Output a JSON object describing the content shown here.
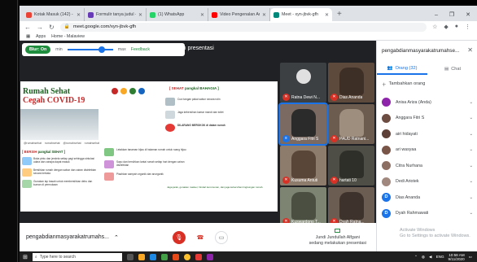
{
  "browser": {
    "tabs": [
      {
        "title": "Kotak Masuk (142) - anise@h",
        "color": "#ea4335",
        "active": false
      },
      {
        "title": "Formulir tanya judul - Googl",
        "color": "#673ab7",
        "active": false
      },
      {
        "title": "(1) WhatsApp",
        "color": "#25d366",
        "active": false
      },
      {
        "title": "Video Pengenalan Arsitektur Ulr",
        "color": "#ff0000",
        "active": false
      },
      {
        "title": "Meet - xyn-jbvk-gfh",
        "color": "#00897b",
        "active": true
      }
    ],
    "new_tab": "+",
    "url": "meet.google.com/xyn-jbvk-gfh",
    "bookmarks": [
      "Apps",
      "Home - Malaview"
    ]
  },
  "blur_bar": {
    "toggle": "Blur: On",
    "min": "min",
    "max": "max",
    "feedback": "Feedback"
  },
  "meet": {
    "presenting_title": "akukan presentasi",
    "meeting_name": "pengabdianmasyarakatrumahs...",
    "presenter_text": "Jundi Jundullah Alfgani",
    "presenter_sub": "sedang melakukan presentasi"
  },
  "slide": {
    "title_line1": "Rumah Sehat",
    "title_line2": "Cegah COVID-19",
    "bersih_prefix": "[ BERSIH",
    "bersih_suffix": "pangkal SEHAT ]",
    "sehat_prefix": "[ SEHAT",
    "sehat_suffix": "pangkal BAHAGIA ]",
    "contacts": [
      "@rumahsehat",
      "rumahsehat",
      "@rumahsehat",
      "rumahsehat"
    ],
    "left_items": [
      "Buka pintu dan jendela setiap pagi sehingga sirkulasi udara dan cahaya dapat masuk",
      "Bersihkan rumah dengan sabun dan cairan disinfektan secara berkala",
      "Gunakan lap basah untuk membersihkan debu dan kuman di permukaan"
    ],
    "mid_items": [
      "Letakkan tanaman hijau di halaman rumah untuk ruang hijau",
      "Sapu dan bersihkan lantai rumah setiap hari dengan cairan disinfektan",
      "Pisahkan sampah organik dan anorganik"
    ],
    "right_items": [
      "Cuci tangan pakai sabun secara rutin",
      "Jaga kebersihan kamar mandi dan toilet",
      "DILARANG MEROKOK di dalam rumah"
    ],
    "bottom_note": "Jaga jarak, gunakan masker, hindari kerumunan, dan jaga kebersihan lingkungan rumah."
  },
  "participants_grid": [
    {
      "name": "Ratna Dewi N...",
      "type": "avatar",
      "color": "#bdbdbd"
    },
    {
      "name": "Dias Ananda",
      "type": "video",
      "color": "#5d4a3c"
    },
    {
      "name": "Anggara Fitri S",
      "type": "video",
      "color": "#7a6a62"
    },
    {
      "name": "PAUD Ratnani...",
      "type": "video",
      "color": "#6c5c50"
    },
    {
      "name": "Kusuma Antuti",
      "type": "video",
      "color": "#8d7b6b"
    },
    {
      "name": "hartati 10",
      "type": "video",
      "color": "#4e4e46"
    },
    {
      "name": "Kuswardono T...",
      "type": "video",
      "color": "#7d8471"
    },
    {
      "name": "Dyah Ratna...",
      "type": "video",
      "color": "#6b5d52"
    }
  ],
  "panel": {
    "title": "pengabdianmasyarakatrumahse...",
    "tab_people": "Orang (32)",
    "tab_chat": "Chat",
    "add_people": "Tambahkan orang",
    "people": [
      {
        "name": "Anisa Ariza (Anda)",
        "color": "#8e24aa",
        "initial": ""
      },
      {
        "name": "Anggara Fitri S",
        "color": "#6d4c41",
        "initial": ""
      },
      {
        "name": "airi hidayati",
        "color": "#5d4037",
        "initial": ""
      },
      {
        "name": "ari wasyaa",
        "color": "#795548",
        "initial": ""
      },
      {
        "name": "Citra Nurhana",
        "color": "#8d6e63",
        "initial": ""
      },
      {
        "name": "Dedi Ariotek",
        "color": "#a1887f",
        "initial": ""
      },
      {
        "name": "Dias Ananda",
        "color": "#1a73e8",
        "initial": "D"
      },
      {
        "name": "Dyah Rahmawati",
        "color": "#1a73e8",
        "initial": "D"
      }
    ],
    "watermark_1": "Activate Windows",
    "watermark_2": "Go to Settings to activate Windows."
  },
  "taskbar": {
    "search": "Type here to search",
    "lang": "ENG",
    "time": "10:58 AM",
    "date": "9/11/2020"
  }
}
